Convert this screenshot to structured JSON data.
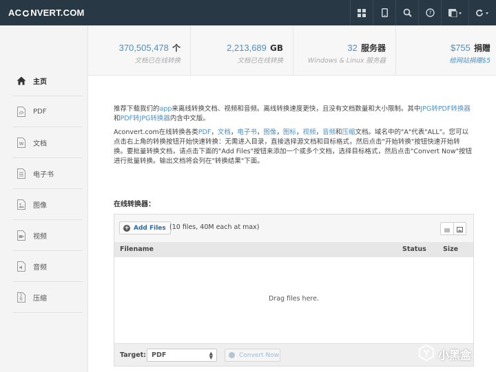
{
  "header": {
    "logo_left": "AC",
    "logo_right": "NVERT.COM",
    "nav_icons": [
      "grid-icon",
      "mobile-icon",
      "search-icon",
      "help-icon",
      "language-icon",
      "refresh-icon"
    ]
  },
  "stats": [
    {
      "num": "370,505,478",
      "unit": "个",
      "sub": "文档已在线转换"
    },
    {
      "num": "2,213,689",
      "unit": "GB",
      "sub": "文档已在线转换"
    },
    {
      "num": "32",
      "unit": "服务器",
      "sub": "Windows & Linux 服务器"
    },
    {
      "num": "$755",
      "unit": "捐赠",
      "sub": "给网站捐赠$5"
    }
  ],
  "sidebar": {
    "items": [
      {
        "label": "主页",
        "icon": "home-icon"
      },
      {
        "label": "PDF",
        "icon": "pdf-file-icon"
      },
      {
        "label": "文档",
        "icon": "word-file-icon"
      },
      {
        "label": "电子书",
        "icon": "ebook-icon"
      },
      {
        "label": "图像",
        "icon": "image-file-icon"
      },
      {
        "label": "视频",
        "icon": "video-file-icon"
      },
      {
        "label": "音频",
        "icon": "audio-file-icon"
      },
      {
        "label": "压缩",
        "icon": "archive-file-icon"
      }
    ]
  },
  "intro": {
    "p1_a": "推荐下载我们的",
    "p1_app": "app",
    "p1_b": "来离线转换文档、视频和音频。离线转换速度更快，且没有文档数量和大小限制。其中",
    "p1_jpg2pdf": "JPG转PDF转换器",
    "p1_c": "和",
    "p1_pdf2jpg": "PDF转JPG转换器",
    "p1_d": "内含中文版。",
    "p2_a": "Aconvert.com在线转换各类",
    "p2_pdf": "PDF",
    "p2_sep1": "，",
    "p2_doc": "文档",
    "p2_sep2": "，",
    "p2_ebook": "电子书",
    "p2_sep3": "，",
    "p2_image": "图像",
    "p2_sep4": "，",
    "p2_icon": "图标",
    "p2_sep5": "，",
    "p2_video": "视频",
    "p2_sep6": "，",
    "p2_audio": "音频",
    "p2_and": "和",
    "p2_archive": "压缩",
    "p2_b": "文档。域名中的\"A\"代表\"ALL\"。您可以点击右上角的转换按钮开始快速转换：无需进入目录，直接选择源文档和目标格式，然后点击\"开始转换\"按钮快速开始转换。要批量转换文档，请点击下面的\"Add Files\"按钮来添加一个或多个文档，选择目标格式，然后点击\"Convert Now\"按钮进行批量转换。输出文档将会列在\"转换结果\"下面。"
  },
  "converter": {
    "title": "在线转换器：",
    "add_files": "Add Files",
    "files_note": "(10 files, 40M each at max)",
    "col_filename": "Filename",
    "col_status": "Status",
    "col_size": "Size",
    "drop_text": "Drag files here.",
    "target_label": "Target:",
    "target_value": "PDF",
    "convert_label": "Convert Now"
  },
  "watermark": {
    "text": "小黑盒"
  },
  "colors": {
    "header_bg": "#283845",
    "link": "#4a90c8",
    "sidebar_bg": "#f4f4f4"
  }
}
